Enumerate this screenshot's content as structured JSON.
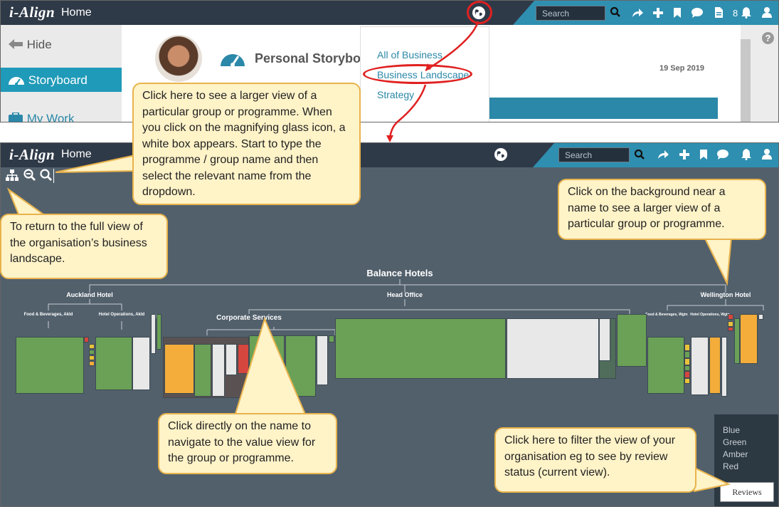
{
  "top_screen": {
    "logo": "i-Align",
    "title": "Home",
    "search_placeholder": "Search",
    "notification_count": "8",
    "sidebar": {
      "hide_label": "Hide",
      "items": [
        "Storyboard",
        "My Work"
      ]
    },
    "page_title": "Personal Storybo",
    "date": "19 Sep 2019",
    "menu": [
      "All of Business",
      "Business Landscape",
      "Strategy"
    ],
    "help_label": "?"
  },
  "bottom_screen": {
    "logo": "i-Align",
    "title": "Home",
    "search_placeholder": "Search",
    "tree": {
      "root": "Balance Hotels",
      "children": [
        "Auckland Hotel",
        "Head Office",
        "Wellington Hotel"
      ],
      "auckland_subs": [
        "Food & Beverages, Akld",
        "Hotel Operations, Akld"
      ],
      "corporate": "Corporate Services",
      "wellington_subs": [
        "Food & Beverages, Wgtn",
        "Hotel Operations, Wgtn"
      ]
    },
    "filter": {
      "options": [
        "Blue",
        "Green",
        "Amber",
        "Red"
      ],
      "button": "Reviews"
    }
  },
  "callouts": {
    "magnify": "Click here to see a larger view of a particular group or programme. When you click on the magnifying glass icon, a white box appears.  Start to type the programme / group name and then select the relevant name from the dropdown.",
    "full_view": "To return to the full view of the organisation’s business landscape.",
    "background": "Click on the background near a name to see a larger view of a particular group or programme.",
    "name": "Click directly on the name to navigate to the value view for the group or programme.",
    "filter": "Click here to filter the view of your organisation eg to see by review status (current view)."
  },
  "colors": {
    "navbar": "#2f3a48",
    "accent": "#1f9ab8",
    "canvas": "#52606c",
    "callout_bg": "#fff3c8",
    "callout_border": "#e8b34c",
    "highlight": "#e02020"
  },
  "icons": [
    "globe-icon",
    "search-icon",
    "share-icon",
    "plus-icon",
    "bookmark-icon",
    "chat-icon",
    "document-icon",
    "bell-icon",
    "user-icon",
    "arrow-left-icon",
    "dashboard-icon",
    "briefcase-icon",
    "hierarchy-icon",
    "zoom-out-icon",
    "zoom-in-icon",
    "help-icon"
  ]
}
